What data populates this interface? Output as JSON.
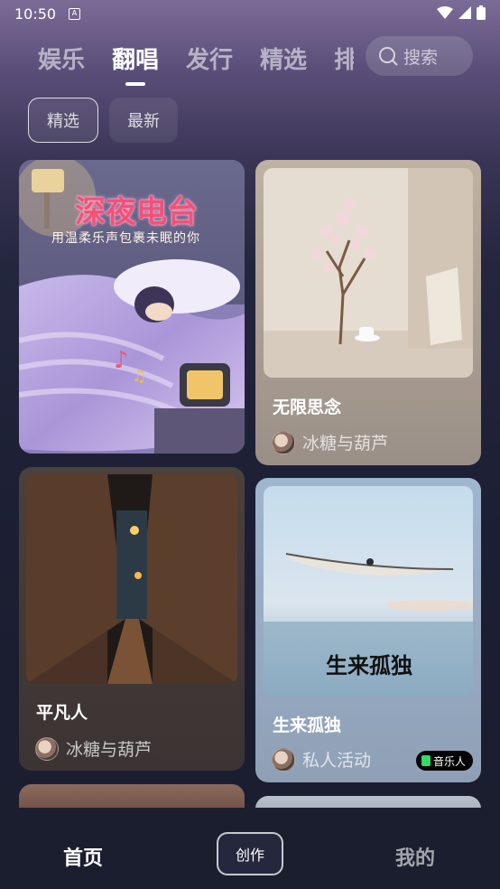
{
  "status_bar": {
    "time": "10:50",
    "notif_letter": "A"
  },
  "tabs": [
    {
      "label": "娱乐"
    },
    {
      "label": "翻唱"
    },
    {
      "label": "发行"
    },
    {
      "label": "精选"
    },
    {
      "label": "排"
    }
  ],
  "active_tab": "翻唱",
  "search": {
    "placeholder": "搜索"
  },
  "filters": [
    {
      "label": "精选"
    },
    {
      "label": "最新"
    }
  ],
  "cards": [
    {
      "overlay_title": "深夜电台",
      "overlay_subtitle": "用温柔乐声包裹未眠的你"
    },
    {
      "title": "无限思念",
      "author": "冰糖与葫芦"
    },
    {
      "title": "平凡人",
      "author": "冰糖与葫芦"
    },
    {
      "title": "生来孤独",
      "overlay_text": "生来孤独",
      "author": "私人活动",
      "badge": "音乐人"
    }
  ],
  "bottom_nav": {
    "home": "首页",
    "create": "创作",
    "mine": "我的"
  },
  "colors": {
    "background": "#1c1f33",
    "accent_green": "#36d86a"
  }
}
